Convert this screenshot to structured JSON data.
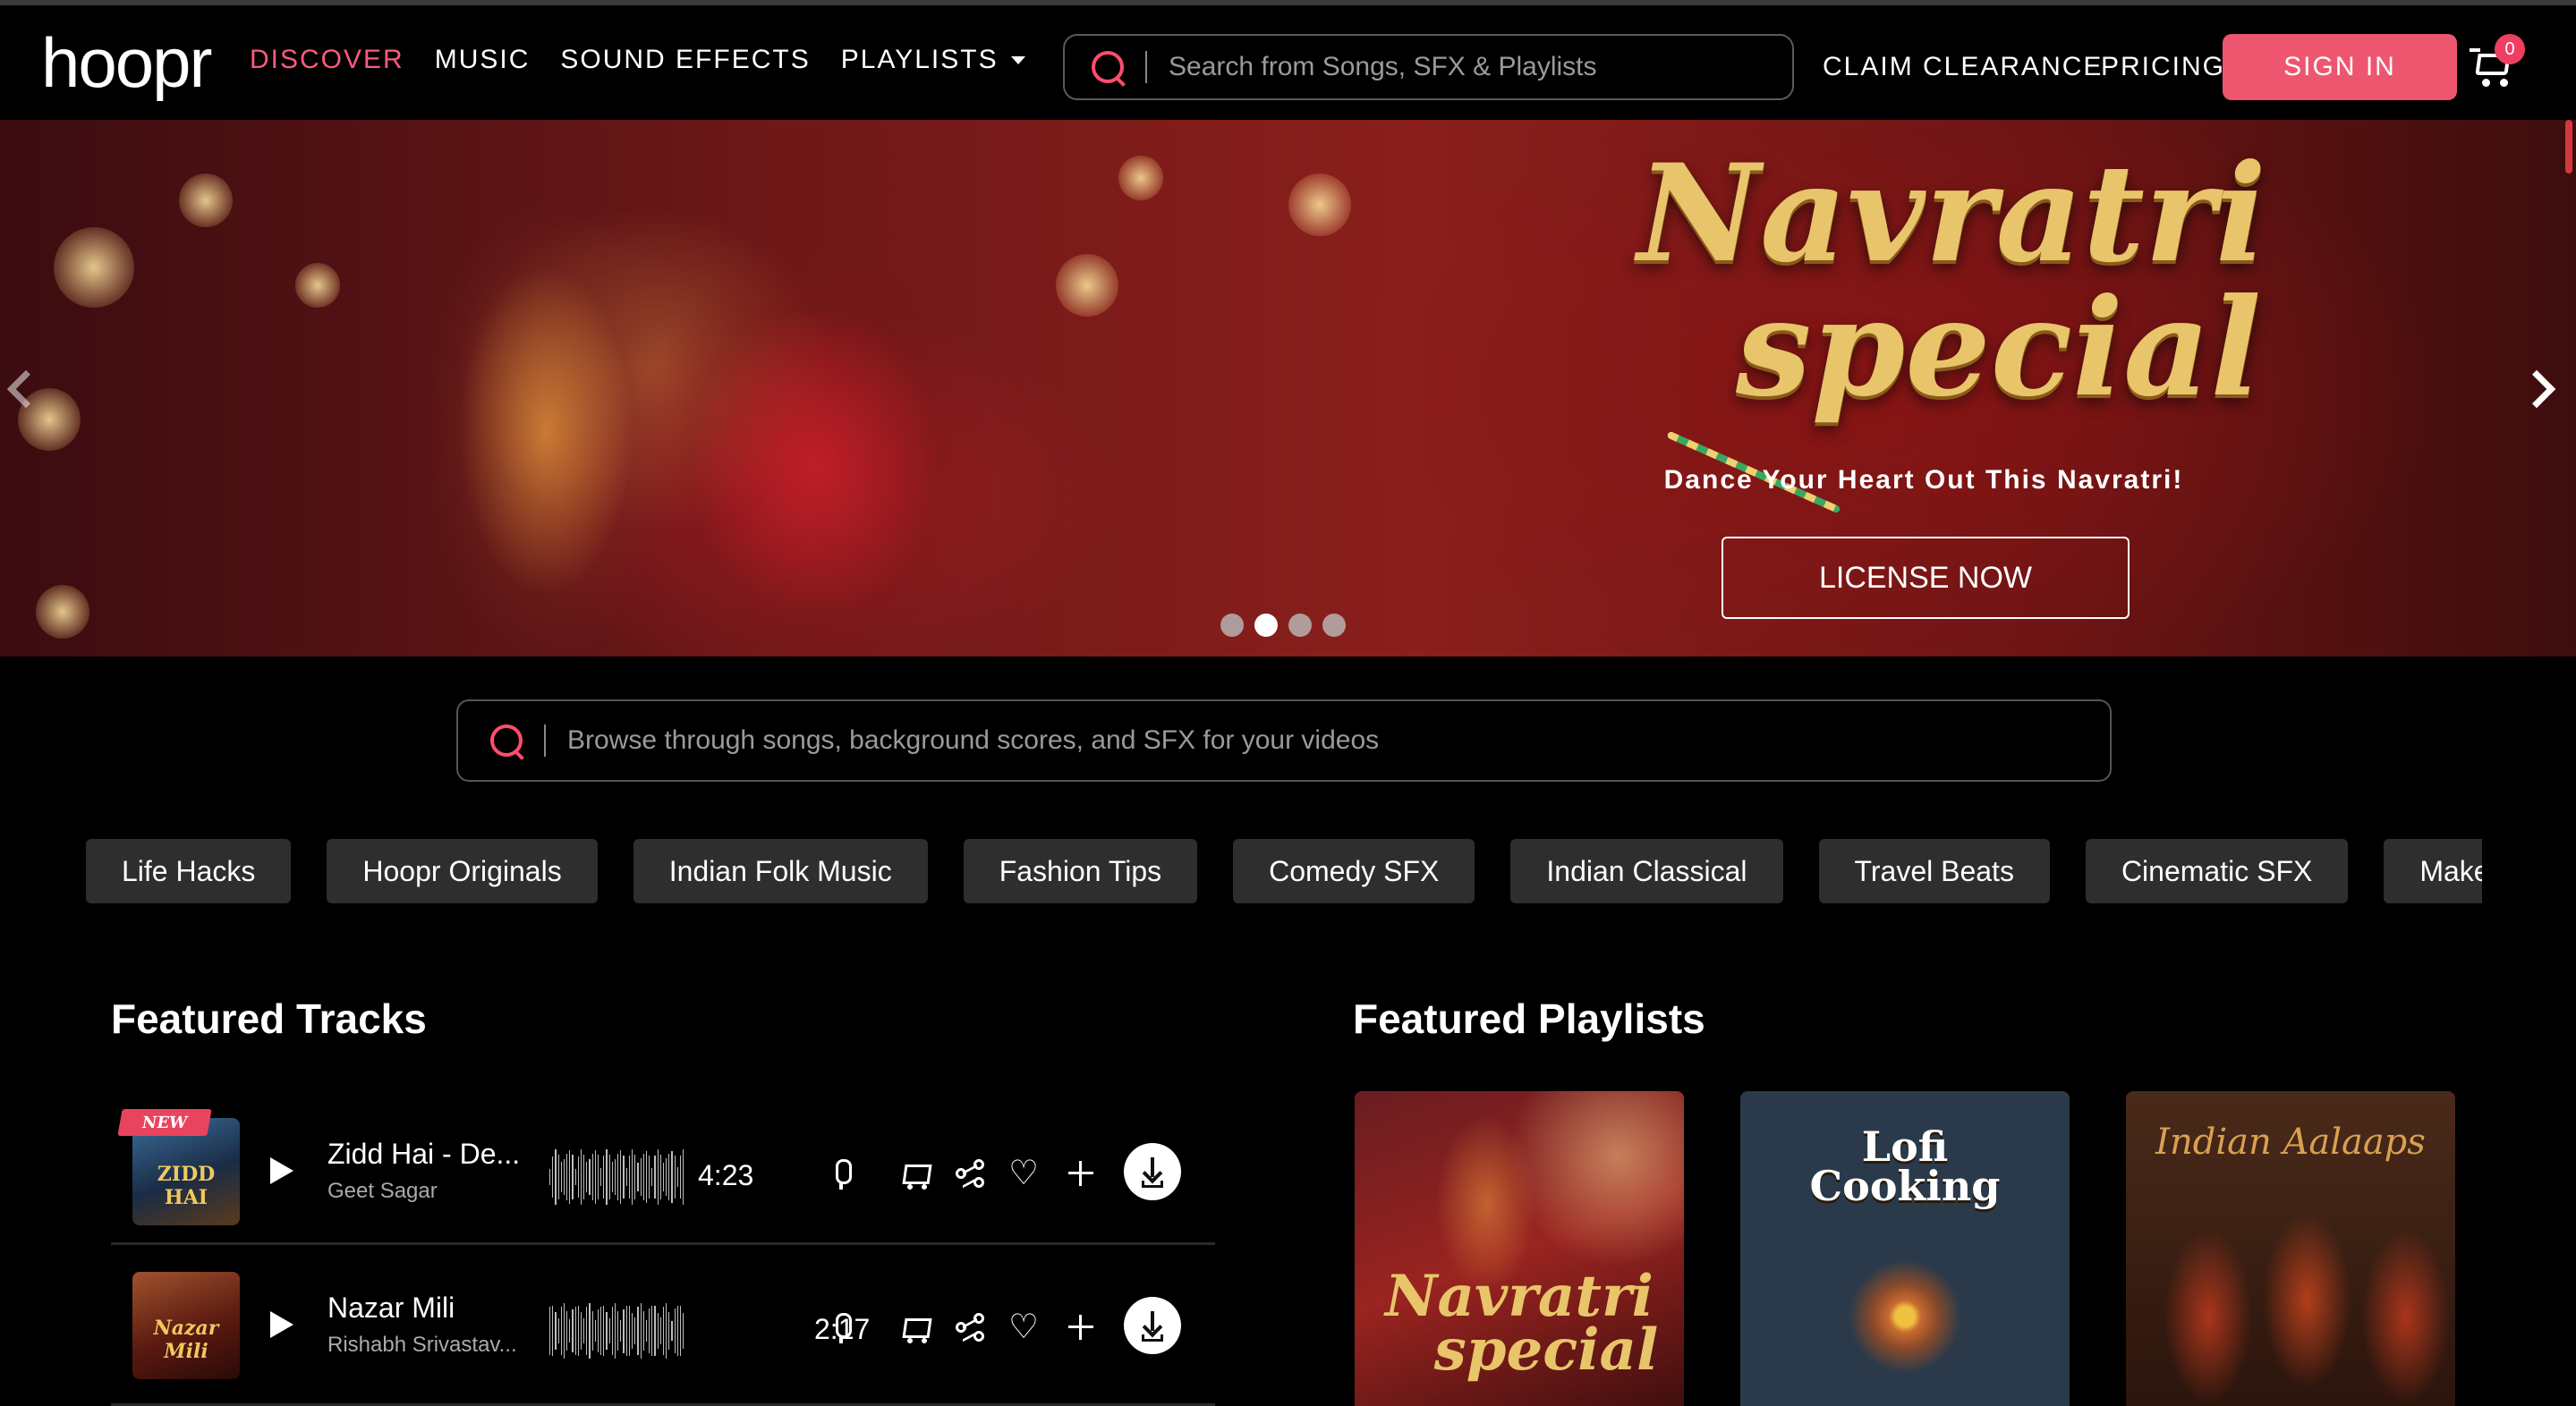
{
  "header": {
    "logo": "hoopr",
    "nav": [
      {
        "label": "DISCOVER",
        "active": true
      },
      {
        "label": "MUSIC",
        "active": false
      },
      {
        "label": "SOUND EFFECTS",
        "active": false
      },
      {
        "label": "PLAYLISTS",
        "active": false
      }
    ],
    "search_placeholder": "Search from Songs, SFX & Playlists",
    "claim_clearance": "CLAIM CLEARANCE",
    "pricing": "PRICING",
    "sign_in": "SIGN IN",
    "cart_count": "0"
  },
  "hero": {
    "title_line1": "Navratri",
    "title_line2": "special",
    "subtitle": "Dance Your Heart Out This Navratri!",
    "cta": "LICENSE NOW",
    "slides_total": 4,
    "active_slide": 2
  },
  "browse": {
    "placeholder": "Browse through songs, background scores, and SFX for your videos"
  },
  "chips": [
    "Life Hacks",
    "Hoopr Originals",
    "Indian Folk Music",
    "Fashion Tips",
    "Comedy SFX",
    "Indian Classical",
    "Travel Beats",
    "Cinematic SFX",
    "Makeup Tu"
  ],
  "featured_tracks": {
    "title": "Featured Tracks",
    "items": [
      {
        "title": "Zidd Hai - De...",
        "artist": "Geet Sagar",
        "duration": "4:23",
        "badge": "NEW",
        "thumb_text": "ZIDD HAI"
      },
      {
        "title": "Nazar Mili",
        "artist": "Rishabh Srivastav...",
        "duration": "2:17",
        "badge": "",
        "thumb_text": "Nazar Mili"
      }
    ]
  },
  "featured_playlists": {
    "title": "Featured Playlists",
    "items": [
      {
        "line1": "Navratri",
        "line2": "special"
      },
      {
        "line1": "Lofi",
        "line2": "Cooking"
      },
      {
        "line1": "Indian Aalaaps",
        "line2": ""
      }
    ]
  },
  "colors": {
    "accent": "#ff5a7d",
    "sign_in_bg": "#ee5670",
    "chip_bg": "#2e2e2e",
    "gold": "#e8c46a"
  }
}
